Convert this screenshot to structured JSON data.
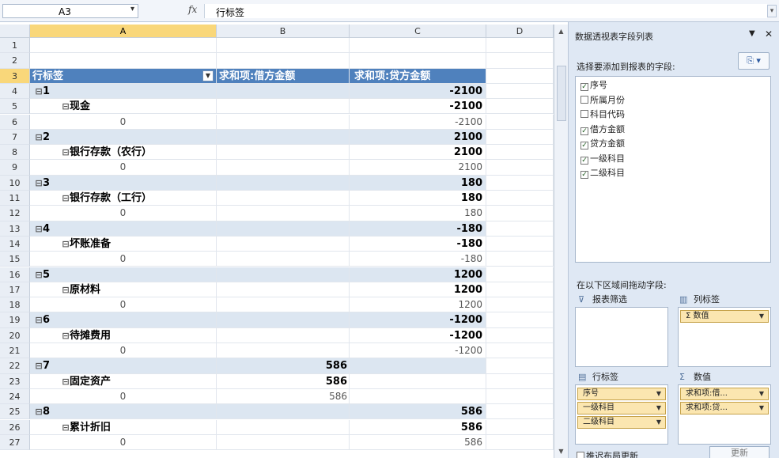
{
  "formula_bar": {
    "name_box": "A3",
    "fx_label": "fx",
    "formula": "行标签"
  },
  "columns": [
    "A",
    "B",
    "C",
    "D"
  ],
  "selected_column": "A",
  "selected_row": 3,
  "rows": [
    {
      "num": "1",
      "kind": "empty",
      "a": "",
      "b": "",
      "c": ""
    },
    {
      "num": "2",
      "kind": "empty",
      "a": "",
      "b": "",
      "c": ""
    },
    {
      "num": "3",
      "kind": "header",
      "a": "行标签",
      "b": "求和项:借方金额",
      "c": "求和项:贷方金额"
    },
    {
      "num": "4",
      "kind": "band",
      "a": "1",
      "b": "",
      "c": "-2100"
    },
    {
      "num": "5",
      "kind": "sub",
      "a": "现金",
      "b": "",
      "c": "-2100"
    },
    {
      "num": "6",
      "kind": "leaf",
      "a": "0",
      "b": "",
      "c": "-2100"
    },
    {
      "num": "7",
      "kind": "band",
      "a": "2",
      "b": "",
      "c": "2100"
    },
    {
      "num": "8",
      "kind": "sub",
      "a": "银行存款（农行）",
      "b": "",
      "c": "2100"
    },
    {
      "num": "9",
      "kind": "leaf",
      "a": "0",
      "b": "",
      "c": "2100"
    },
    {
      "num": "10",
      "kind": "band",
      "a": "3",
      "b": "",
      "c": "180"
    },
    {
      "num": "11",
      "kind": "sub",
      "a": "银行存款（工行）",
      "b": "",
      "c": "180"
    },
    {
      "num": "12",
      "kind": "leaf",
      "a": "0",
      "b": "",
      "c": "180"
    },
    {
      "num": "13",
      "kind": "band",
      "a": "4",
      "b": "",
      "c": "-180"
    },
    {
      "num": "14",
      "kind": "sub",
      "a": "坏账准备",
      "b": "",
      "c": "-180"
    },
    {
      "num": "15",
      "kind": "leaf",
      "a": "0",
      "b": "",
      "c": "-180"
    },
    {
      "num": "16",
      "kind": "band",
      "a": "5",
      "b": "",
      "c": "1200"
    },
    {
      "num": "17",
      "kind": "sub",
      "a": "原材料",
      "b": "",
      "c": "1200"
    },
    {
      "num": "18",
      "kind": "leaf",
      "a": "0",
      "b": "",
      "c": "1200"
    },
    {
      "num": "19",
      "kind": "band",
      "a": "6",
      "b": "",
      "c": "-1200"
    },
    {
      "num": "20",
      "kind": "sub",
      "a": "待摊费用",
      "b": "",
      "c": "-1200"
    },
    {
      "num": "21",
      "kind": "leaf",
      "a": "0",
      "b": "",
      "c": "-1200"
    },
    {
      "num": "22",
      "kind": "band",
      "a": "7",
      "b": "586",
      "c": ""
    },
    {
      "num": "23",
      "kind": "sub",
      "a": "固定资产",
      "b": "586",
      "c": ""
    },
    {
      "num": "24",
      "kind": "leaf",
      "a": "0",
      "b": "586",
      "c": ""
    },
    {
      "num": "25",
      "kind": "band",
      "a": "8",
      "b": "",
      "c": "586"
    },
    {
      "num": "26",
      "kind": "sub",
      "a": "累计折旧",
      "b": "",
      "c": "586"
    },
    {
      "num": "27",
      "kind": "leaf",
      "a": "0",
      "b": "",
      "c": "586"
    }
  ],
  "pivot_pane": {
    "title": "数据透视表字段列表",
    "choose_label": "选择要添加到报表的字段:",
    "fields": [
      {
        "label": "序号",
        "checked": true
      },
      {
        "label": "所属月份",
        "checked": false
      },
      {
        "label": "科目代码",
        "checked": false
      },
      {
        "label": "借方金额",
        "checked": true
      },
      {
        "label": "贷方金额",
        "checked": true
      },
      {
        "label": "一级科目",
        "checked": true
      },
      {
        "label": "二级科目",
        "checked": true
      }
    ],
    "drag_label": "在以下区域间拖动字段:",
    "report_filter_label": "报表筛选",
    "column_labels_label": "列标签",
    "row_labels_label": "行标签",
    "values_label": "数值",
    "column_chips": [
      "Σ 数值"
    ],
    "row_chips": [
      "序号",
      "一级科目",
      "二级科目"
    ],
    "value_chips": [
      "求和项:借...",
      "求和项:贷..."
    ],
    "defer_label": "推迟布局更新",
    "update_button": "更新"
  }
}
